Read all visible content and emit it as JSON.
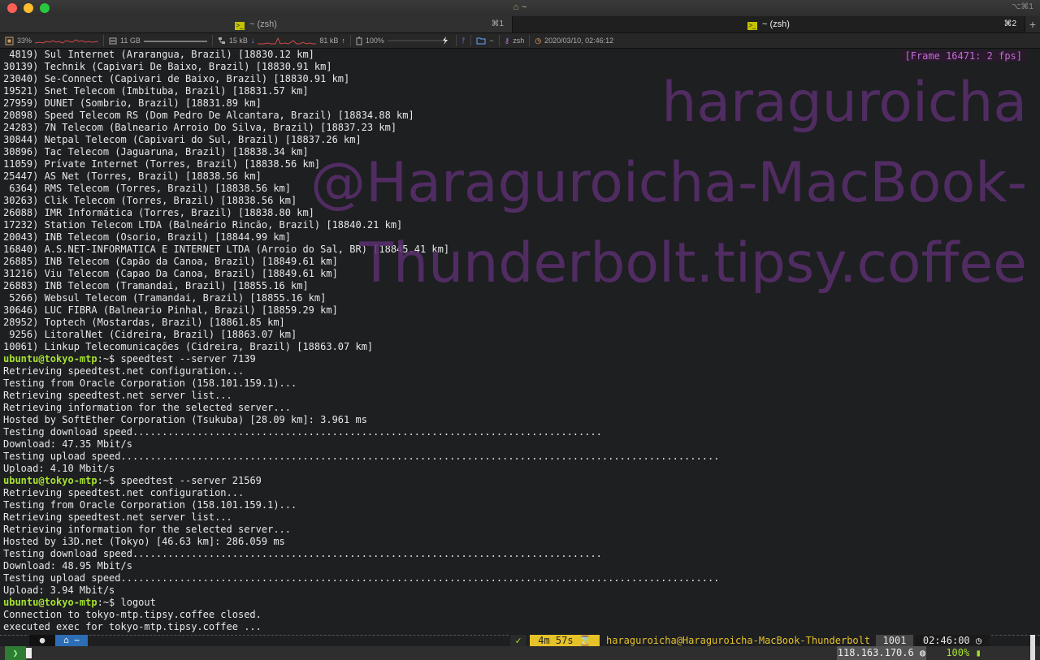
{
  "window": {
    "title": "~",
    "shortcut": "⌥⌘1"
  },
  "tabs": [
    {
      "label": "~ (zsh)",
      "shortcut": "⌘1"
    },
    {
      "label": "~ (zsh)",
      "shortcut": "⌘2"
    }
  ],
  "new_tab_label": "+",
  "status_bar": {
    "cpu": "33%",
    "memory": "11 GB",
    "net_down": "15 kB",
    "net_up": "81 kB",
    "battery": "100%",
    "folder": "~",
    "shell": "zsh",
    "datetime": "2020/03/10, 02:46:12"
  },
  "overlay": {
    "frame_counter": "[Frame 16471: 2 fps]",
    "watermark_lines": [
      "haraguroicha",
      "@Haraguroicha-MacBook-",
      "Thunderbolt.tipsy.coffee"
    ]
  },
  "terminal_lines": [
    " 4819) Sul Internet (Ararangua, Brazil) [18830.12 km]",
    "30139) Technik (Capivari De Baixo, Brazil) [18830.91 km]",
    "23040) Se-Connect (Capivari de Baixo, Brazil) [18830.91 km]",
    "19521) Snet Telecom (Imbituba, Brazil) [18831.57 km]",
    "27959) DUNET (Sombrio, Brazil) [18831.89 km]",
    "20898) Speed Telecom RS (Dom Pedro De Alcantara, Brazil) [18834.88 km]",
    "24283) 7N Telecom (Balneario Arroio Do Silva, Brazil) [18837.23 km]",
    "30844) Netpal Telecom (Capivari do Sul, Brazil) [18837.26 km]",
    "30896) Tac Telecom (Jaguaruna, Brazil) [18838.34 km]",
    "11059) Prívate Internet (Torres, Brazil) [18838.56 km]",
    "25447) AS Net (Torres, Brazil) [18838.56 km]",
    " 6364) RMS Telecom (Torres, Brazil) [18838.56 km]",
    "30263) Clik Telecom (Torres, Brazil) [18838.56 km]",
    "26088) IMR Informática (Torres, Brazil) [18838.80 km]",
    "17232) Station Telecom LTDA (Balneário Rincão, Brazil) [18840.21 km]",
    "20043) INB Telecom (Osorio, Brazil) [18844.99 km]",
    "16840) A.S.NET-INFORMATICA E INTERNET LTDA (Arroio do Sal, BR) [18845.41 km]",
    "26885) INB Telecom (Capão da Canoa, Brazil) [18849.61 km]",
    "31216) Viu Telecom (Capao Da Canoa, Brazil) [18849.61 km]",
    "26883) INB Telecom (Tramandai, Brazil) [18855.16 km]",
    " 5266) Websul Telecom (Tramandai, Brazil) [18855.16 km]",
    "30646) LUC FIBRA (Balneario Pinhal, Brazil) [18859.29 km]",
    "28952) Toptech (Mostardas, Brazil) [18861.85 km]",
    " 9256) LitoralNet (Cidreira, Brazil) [18863.07 km]",
    "10061) Linkup Telecomunicações (Cidreira, Brazil) [18863.07 km]"
  ],
  "session_1": {
    "prompt": "ubuntu@tokyo-mtp",
    "path": ":~$ ",
    "command": "speedtest --server 7139",
    "output": [
      "Retrieving speedtest.net configuration...",
      "Testing from Oracle Corporation (158.101.159.1)...",
      "Retrieving speedtest.net server list...",
      "Retrieving information for the selected server...",
      "Hosted by SoftEther Corporation (Tsukuba) [28.09 km]: 3.961 ms",
      "Testing download speed................................................................................",
      "Download: 47.35 Mbit/s",
      "Testing upload speed......................................................................................................",
      "Upload: 4.10 Mbit/s"
    ]
  },
  "session_2": {
    "prompt": "ubuntu@tokyo-mtp",
    "path": ":~$ ",
    "command": "speedtest --server 21569",
    "output": [
      "Retrieving speedtest.net configuration...",
      "Testing from Oracle Corporation (158.101.159.1)...",
      "Retrieving speedtest.net server list...",
      "Retrieving information for the selected server...",
      "Hosted by i3D.net (Tokyo) [46.63 km]: 286.059 ms",
      "Testing download speed................................................................................",
      "Download: 48.95 Mbit/s",
      "Testing upload speed......................................................................................................",
      "Upload: 3.94 Mbit/s"
    ]
  },
  "session_3": {
    "prompt": "ubuntu@tokyo-mtp",
    "path": ":~$ ",
    "command": "logout",
    "output": [
      "Connection to tokyo-mtp.tipsy.coffee closed.",
      "executed exec for tokyo-mtp.tipsy.coffee ..."
    ]
  },
  "powerline": {
    "check": "✓",
    "duration": "4m 57s",
    "hourglass": "⌛",
    "user_host": "haraguroicha@Haraguroicha-MacBook-Thunderbolt",
    "history": "1001",
    "time": "02:46:00",
    "clock_icon": "◷"
  },
  "bottom_bar": {
    "path": "~",
    "prompt_char": "❯",
    "ip": "118.163.170.6",
    "battery": "100%"
  }
}
